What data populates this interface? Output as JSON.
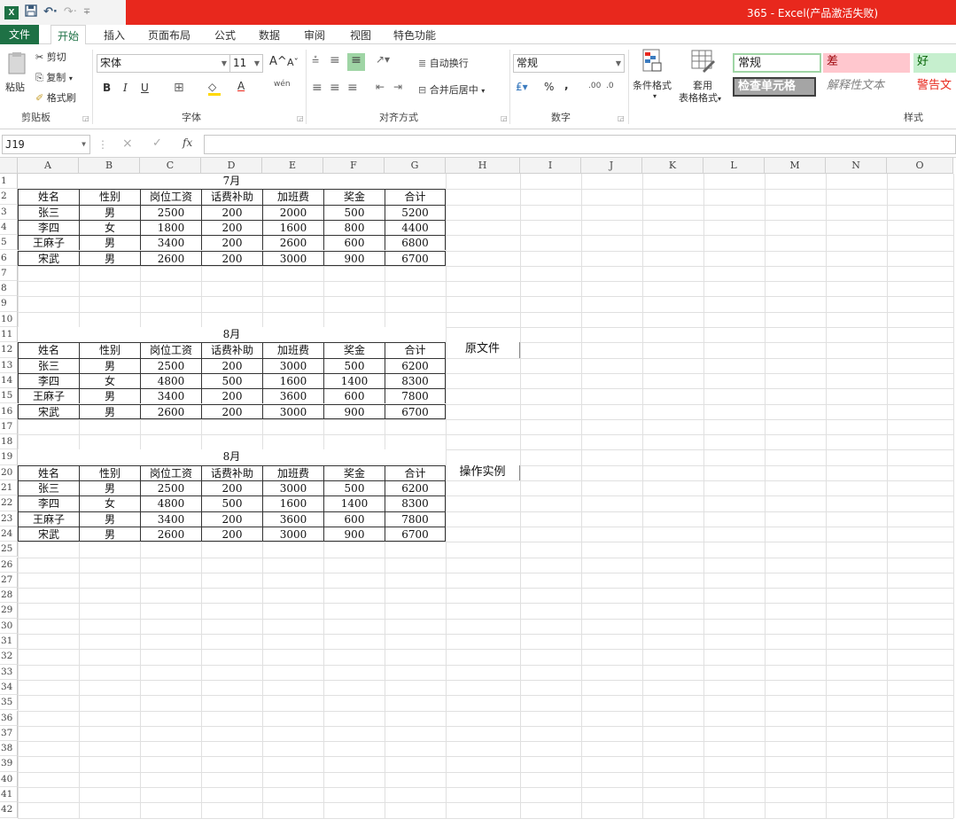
{
  "window": {
    "title": "365 -  Excel(产品激活失败)",
    "qat": {
      "logo": "X",
      "save_icon": "save-icon",
      "undo": "↶·",
      "redo": "↷·",
      "more": "∓"
    }
  },
  "tabs": [
    "文件",
    "开始",
    "插入",
    "页面布局",
    "公式",
    "数据",
    "审阅",
    "视图",
    "特色功能"
  ],
  "ribbon": {
    "clipboard": {
      "paste": "粘贴",
      "cut": "剪切",
      "copy": "复制",
      "format_painter": "格式刷",
      "label": "剪贴板"
    },
    "font": {
      "name": "宋体",
      "size": "11",
      "grow": "A^",
      "shrink": "Aˇ",
      "bold": "B",
      "italic": "I",
      "underline": "U",
      "border": "⊞",
      "fill": "◇",
      "font_color": "A",
      "phonetic": "wén",
      "label": "字体"
    },
    "alignment": {
      "wrap": "自动换行",
      "merge": "合并后居中",
      "label": "对齐方式"
    },
    "number": {
      "format": "常规",
      "percent": "%",
      "comma": ",",
      "inc": ".00",
      "dec": ".0",
      "label": "数字"
    },
    "styles": {
      "conditional": "条件格式",
      "table_format_line1": "套用",
      "table_format_line2": "表格格式",
      "normal": "常规",
      "bad": "差",
      "good": "好",
      "check_cell": "检查单元格",
      "explanatory": "解释性文本",
      "warning": "警告文",
      "label": "样式"
    }
  },
  "formula_bar": {
    "name_box": "J19",
    "cancel": "×",
    "enter": "✓",
    "fx": "fx",
    "formula": ""
  },
  "sheet": {
    "columns": [
      "A",
      "B",
      "C",
      "D",
      "E",
      "F",
      "G",
      "H",
      "I",
      "J",
      "K",
      "L",
      "M",
      "N",
      "O"
    ],
    "rows": [
      "1",
      "2",
      "3",
      "4",
      "5",
      "6",
      "7",
      "8",
      "9",
      "10",
      "11",
      "12",
      "13",
      "14",
      "15",
      "16",
      "17",
      "18",
      "19",
      "20",
      "21",
      "22",
      "23",
      "24",
      "25",
      "26",
      "27",
      "28",
      "29",
      "30",
      "31",
      "32",
      "33",
      "34",
      "35",
      "36",
      "37",
      "38",
      "39",
      "40",
      "41",
      "42"
    ],
    "tables": [
      {
        "month": "7月",
        "headers": [
          "姓名",
          "性别",
          "岗位工资",
          "话费补助",
          "加班费",
          "奖金",
          "合计"
        ],
        "rows": [
          [
            "张三",
            "男",
            "2500",
            "200",
            "2000",
            "500",
            "5200"
          ],
          [
            "李四",
            "女",
            "1800",
            "200",
            "1600",
            "800",
            "4400"
          ],
          [
            "王麻子",
            "男",
            "3400",
            "200",
            "2600",
            "600",
            "6800"
          ],
          [
            "宋武",
            "男",
            "2600",
            "200",
            "3000",
            "900",
            "6700"
          ]
        ],
        "note": ""
      },
      {
        "month": "8月",
        "headers": [
          "姓名",
          "性别",
          "岗位工资",
          "话费补助",
          "加班费",
          "奖金",
          "合计"
        ],
        "rows": [
          [
            "张三",
            "男",
            "2500",
            "200",
            "3000",
            "500",
            "6200"
          ],
          [
            "李四",
            "女",
            "4800",
            "500",
            "1600",
            "1400",
            "8300"
          ],
          [
            "王麻子",
            "男",
            "3400",
            "200",
            "3600",
            "600",
            "7800"
          ],
          [
            "宋武",
            "男",
            "2600",
            "200",
            "3000",
            "900",
            "6700"
          ]
        ],
        "note": "原文件"
      },
      {
        "month": "8月",
        "headers": [
          "姓名",
          "性别",
          "岗位工资",
          "话费补助",
          "加班费",
          "奖金",
          "合计"
        ],
        "rows": [
          [
            "张三",
            "男",
            "2500",
            "200",
            "3000",
            "500",
            "6200"
          ],
          [
            "李四",
            "女",
            "4800",
            "500",
            "1600",
            "1400",
            "8300"
          ],
          [
            "王麻子",
            "男",
            "3400",
            "200",
            "3600",
            "600",
            "7800"
          ],
          [
            "宋武",
            "男",
            "2600",
            "200",
            "3000",
            "900",
            "6700"
          ]
        ],
        "note": "操作实例"
      }
    ]
  },
  "colors": {
    "title_bar": "#e8281d",
    "excel_green": "#1e7145",
    "style_bad": "#ffc7ce",
    "style_good": "#c6efce",
    "check_cell": "#a5a5a5"
  }
}
